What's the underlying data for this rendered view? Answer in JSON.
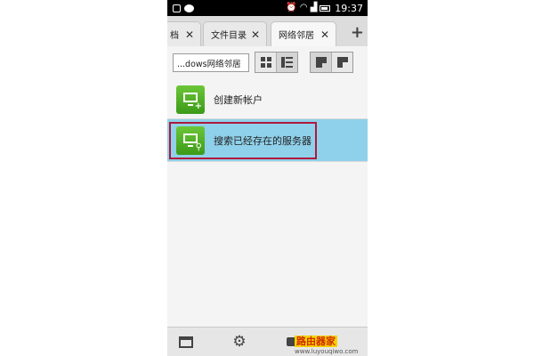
{
  "status_bar": {
    "time": "19:37",
    "left_icons": [
      "notification-icon",
      "wechat-icon"
    ],
    "right_icons": [
      "alarm-icon",
      "wifi-icon",
      "signal-icon",
      "battery-icon"
    ]
  },
  "tabs": [
    {
      "label": "档",
      "close": "✕",
      "active": false
    },
    {
      "label": "文件目录",
      "close": "✕",
      "active": false
    },
    {
      "label": "网络邻居",
      "close": "✕",
      "active": true
    }
  ],
  "new_tab": "+",
  "toolbar": {
    "path": "...dows网络邻居"
  },
  "list": [
    {
      "label": "创建新帐户",
      "icon": "monitor-add-icon",
      "badge": "+",
      "selected": false
    },
    {
      "label": "搜索已经存在的服务器",
      "icon": "monitor-search-icon",
      "badge": "⚲",
      "selected": true
    }
  ],
  "bottom_bar": {
    "icons": [
      "store-icon",
      "settings-gear-icon",
      "chat-icon"
    ]
  },
  "watermark": {
    "title": "路由器家",
    "url": "www.luyouqiwo.com"
  },
  "colors": {
    "selected_row": "#8fd0ea",
    "highlight_border": "#b0183a",
    "icon_green": "#4fae24"
  }
}
